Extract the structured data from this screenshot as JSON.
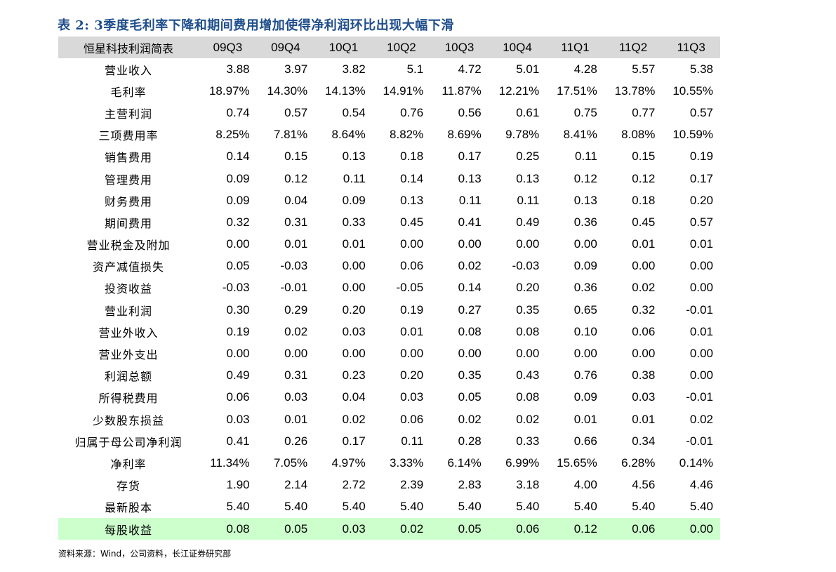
{
  "title": "表 2:  3季度毛利率下降和期间费用增加使得净利润环比出现大幅下滑",
  "table": {
    "header_label": "恒星科技利润简表",
    "columns": [
      "09Q3",
      "09Q4",
      "10Q1",
      "10Q2",
      "10Q3",
      "10Q4",
      "11Q1",
      "11Q2",
      "11Q3"
    ],
    "rows": [
      {
        "label": "营业收入",
        "values": [
          "3.88",
          "3.97",
          "3.82",
          "5.1",
          "4.72",
          "5.01",
          "4.28",
          "5.57",
          "5.38"
        ]
      },
      {
        "label": "毛利率",
        "values": [
          "18.97%",
          "14.30%",
          "14.13%",
          "14.91%",
          "11.87%",
          "12.21%",
          "17.51%",
          "13.78%",
          "10.55%"
        ]
      },
      {
        "label": "主营利润",
        "values": [
          "0.74",
          "0.57",
          "0.54",
          "0.76",
          "0.56",
          "0.61",
          "0.75",
          "0.77",
          "0.57"
        ]
      },
      {
        "label": "三项费用率",
        "values": [
          "8.25%",
          "7.81%",
          "8.64%",
          "8.82%",
          "8.69%",
          "9.78%",
          "8.41%",
          "8.08%",
          "10.59%"
        ]
      },
      {
        "label": "销售费用",
        "values": [
          "0.14",
          "0.15",
          "0.13",
          "0.18",
          "0.17",
          "0.25",
          "0.11",
          "0.15",
          "0.19"
        ]
      },
      {
        "label": "管理费用",
        "values": [
          "0.09",
          "0.12",
          "0.11",
          "0.14",
          "0.13",
          "0.13",
          "0.12",
          "0.12",
          "0.17"
        ]
      },
      {
        "label": "财务费用",
        "values": [
          "0.09",
          "0.04",
          "0.09",
          "0.13",
          "0.11",
          "0.11",
          "0.13",
          "0.18",
          "0.20"
        ]
      },
      {
        "label": "期间费用",
        "values": [
          "0.32",
          "0.31",
          "0.33",
          "0.45",
          "0.41",
          "0.49",
          "0.36",
          "0.45",
          "0.57"
        ]
      },
      {
        "label": "营业税金及附加",
        "values": [
          "0.00",
          "0.01",
          "0.01",
          "0.00",
          "0.00",
          "0.00",
          "0.00",
          "0.01",
          "0.01"
        ]
      },
      {
        "label": "资产减值损失",
        "values": [
          "0.05",
          "-0.03",
          "0.00",
          "0.06",
          "0.02",
          "-0.03",
          "0.09",
          "0.00",
          "0.00"
        ]
      },
      {
        "label": "投资收益",
        "values": [
          "-0.03",
          "-0.01",
          "0.00",
          "-0.05",
          "0.14",
          "0.20",
          "0.36",
          "0.02",
          "0.00"
        ]
      },
      {
        "label": "营业利润",
        "values": [
          "0.30",
          "0.29",
          "0.20",
          "0.19",
          "0.27",
          "0.35",
          "0.65",
          "0.32",
          "-0.01"
        ]
      },
      {
        "label": "营业外收入",
        "values": [
          "0.19",
          "0.02",
          "0.03",
          "0.01",
          "0.08",
          "0.08",
          "0.10",
          "0.06",
          "0.01"
        ]
      },
      {
        "label": "营业外支出",
        "values": [
          "0.00",
          "0.00",
          "0.00",
          "0.00",
          "0.00",
          "0.00",
          "0.00",
          "0.00",
          "0.00"
        ]
      },
      {
        "label": "利润总额",
        "values": [
          "0.49",
          "0.31",
          "0.23",
          "0.20",
          "0.35",
          "0.43",
          "0.76",
          "0.38",
          "0.00"
        ]
      },
      {
        "label": "所得税费用",
        "values": [
          "0.06",
          "0.03",
          "0.04",
          "0.03",
          "0.05",
          "0.08",
          "0.09",
          "0.03",
          "-0.01"
        ]
      },
      {
        "label": "少数股东损益",
        "values": [
          "0.03",
          "0.01",
          "0.02",
          "0.06",
          "0.02",
          "0.02",
          "0.01",
          "0.01",
          "0.02"
        ]
      },
      {
        "label": "归属于母公司净利润",
        "values": [
          "0.41",
          "0.26",
          "0.17",
          "0.11",
          "0.28",
          "0.33",
          "0.66",
          "0.34",
          "-0.01"
        ]
      },
      {
        "label": "净利率",
        "values": [
          "11.34%",
          "7.05%",
          "4.97%",
          "3.33%",
          "6.14%",
          "6.99%",
          "15.65%",
          "6.28%",
          "0.14%"
        ]
      },
      {
        "label": "存货",
        "values": [
          "1.90",
          "2.14",
          "2.72",
          "2.39",
          "2.83",
          "3.18",
          "4.00",
          "4.56",
          "4.46"
        ]
      },
      {
        "label": "最新股本",
        "values": [
          "5.40",
          "5.40",
          "5.40",
          "5.40",
          "5.40",
          "5.40",
          "5.40",
          "5.40",
          "5.40"
        ]
      },
      {
        "label": "每股收益",
        "values": [
          "0.08",
          "0.05",
          "0.03",
          "0.02",
          "0.05",
          "0.06",
          "0.12",
          "0.06",
          "0.00"
        ],
        "highlight": true
      }
    ]
  },
  "source": "资料来源：Wind，公司资料，长江证券研究部",
  "colors": {
    "title": "#1f4e8c",
    "header_bg": "#d9d9d9",
    "highlight_bg": "#ccffcc"
  }
}
